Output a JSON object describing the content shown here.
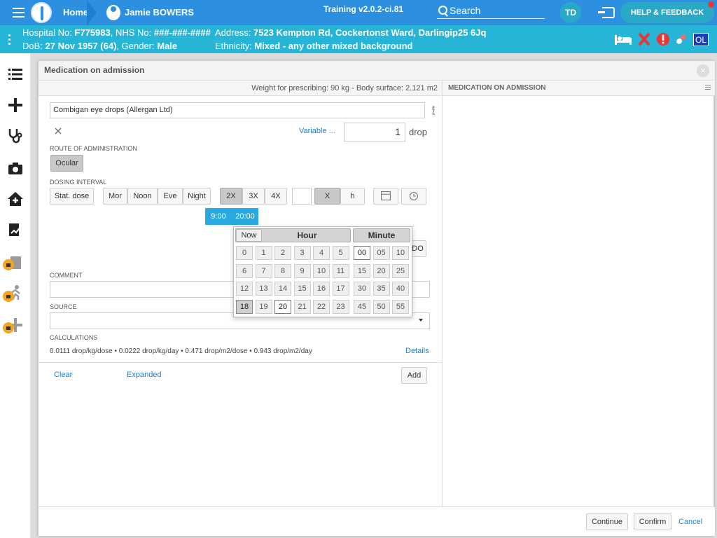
{
  "header": {
    "home_label": "Home",
    "patient_name": "Jamie BOWERS",
    "training": "Training v2.0.2-ci.81",
    "search_label": "Search",
    "avatar_initials": "TD",
    "help_label": "HELP & FEEDBACK"
  },
  "patient": {
    "line1_prefix": "Hospital No: ",
    "hospital_no": "F775983",
    "nhs_prefix": ", NHS No: ",
    "nhs_no": "###-###-####",
    "dob_prefix": "DoB: ",
    "dob": "27 Nov 1957 (64)",
    "gender_prefix": ", Gender: ",
    "gender": "Male",
    "address_prefix": "Address: ",
    "address": "7523 Kempton Rd, Cockertonst Ward, Darlingip25 6Jq",
    "ethnicity_prefix": "Ethnicity: ",
    "ethnicity": "Mixed - any other mixed background",
    "ol_badge": "OL"
  },
  "dialog": {
    "title": "Medication on admission",
    "weight_info": "Weight for prescribing: 90 kg - Body surface: 2.121 m2",
    "right_panel_title": "MEDICATION ON ADMISSION",
    "drug": "Combigan eye drops (Allergan Ltd)",
    "variable_link": "Variable ...",
    "dose_value": "1",
    "dose_unit": "drop",
    "route_label": "ROUTE OF ADMINISTRATION",
    "route_button": "Ocular",
    "dosing_label": "DOSING INTERVAL",
    "stat_dose": "Stat. dose",
    "times": [
      "Mor",
      "Noon",
      "Eve",
      "Night"
    ],
    "freq": [
      "2X",
      "3X",
      "4X"
    ],
    "x_label": "X",
    "h_label": "h",
    "chip_1": "9:00",
    "chip_2": "20:00",
    "comment_label": "COMMENT",
    "source_label": "SOURCE",
    "calc_label": "CALCULATIONS",
    "calc_text": "0.0111 drop/kg/dose • 0.0222 drop/kg/day • 0.471 drop/m2/dose • 0.943 drop/m2/day",
    "details_link": "Details",
    "clear_link": "Clear",
    "expanded_link": "Expanded",
    "add_button": "Add",
    "hidden_button_tail": "DO"
  },
  "picker": {
    "now_label": "Now",
    "hour_label": "Hour",
    "minute_label": "Minute",
    "hours": [
      [
        "0",
        "1",
        "2",
        "3",
        "4",
        "5"
      ],
      [
        "6",
        "7",
        "8",
        "9",
        "10",
        "11"
      ],
      [
        "12",
        "13",
        "14",
        "15",
        "16",
        "17"
      ],
      [
        "18",
        "19",
        "20",
        "21",
        "22",
        "23"
      ]
    ],
    "minutes": [
      [
        "00",
        "05",
        "10"
      ],
      [
        "15",
        "20",
        "25"
      ],
      [
        "30",
        "35",
        "40"
      ],
      [
        "45",
        "50",
        "55"
      ]
    ],
    "selected_hour": "20",
    "active_hour": "18",
    "selected_minute": "00"
  },
  "footer": {
    "continue": "Continue",
    "confirm": "Confirm",
    "cancel": "Cancel"
  }
}
